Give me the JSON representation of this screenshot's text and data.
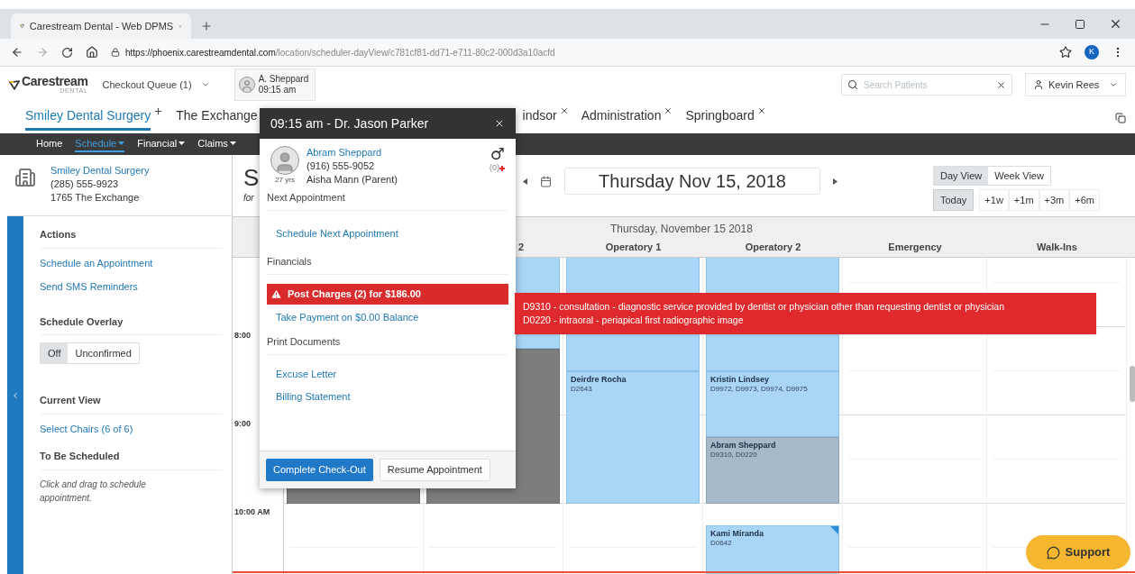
{
  "browser": {
    "tab_title": "Carestream Dental - Web DPMS",
    "url_host": "https://phoenix.carestreamdental.com",
    "url_path": "/location/scheduler-dayView/c781cf81-dd71-e711-80c2-000d3a10acfd",
    "profile_initial": "K"
  },
  "header": {
    "logo": "Carestream",
    "logo_sub": "DENTAL",
    "checkout_queue": "Checkout Queue (1)",
    "queue_chip": {
      "name": "A. Sheppard",
      "time": "09:15 am"
    },
    "search": {
      "placeholder": "Search Patients"
    },
    "user": "Kevin Rees"
  },
  "location_tabs": [
    {
      "label": "Smiley Dental Surgery",
      "selected": true,
      "kind": "add"
    },
    {
      "label": "The Exchange",
      "selected": false,
      "kind": "plain"
    },
    {
      "label": "indsor",
      "selected": false,
      "kind": "close"
    },
    {
      "label": "Administration",
      "selected": false,
      "kind": "close"
    },
    {
      "label": "Springboard",
      "selected": false,
      "kind": "close"
    }
  ],
  "nav": [
    {
      "label": "Home",
      "selected": false,
      "dropdown": false
    },
    {
      "label": "Schedule",
      "selected": true,
      "dropdown": true
    },
    {
      "label": "Financial",
      "selected": false,
      "dropdown": true
    },
    {
      "label": "Claims",
      "selected": false,
      "dropdown": true
    }
  ],
  "location": {
    "name": "Smiley Dental Surgery",
    "phone": "(285) 555-9923",
    "address": "1765 The Exchange"
  },
  "sidebar": {
    "actions_title": "Actions",
    "actions": [
      "Schedule an Appointment",
      "Send SMS Reminders"
    ],
    "overlay_title": "Schedule Overlay",
    "overlay_options": [
      {
        "label": "Off",
        "selected": true
      },
      {
        "label": "Unconfirmed",
        "selected": false
      }
    ],
    "current_view_title": "Current View",
    "current_view_link": "Select Chairs (6 of 6)",
    "to_be_scheduled_title": "To Be Scheduled",
    "to_be_scheduled_note": "Click and drag to schedule appointment."
  },
  "schedule": {
    "title_fragment": "S",
    "subtitle_fragment": "for",
    "date": "Thursday Nov 15, 2018",
    "view_options": [
      {
        "label": "Day View",
        "selected": true
      },
      {
        "label": "Week View",
        "selected": false
      }
    ],
    "today": "Today",
    "jumps": [
      "+1w",
      "+1m",
      "+3m",
      "+6m"
    ]
  },
  "grid": {
    "date_heading": "Thursday, November 15 2018",
    "times": [
      "8:00",
      "9:00",
      "10:00 AM"
    ],
    "columns": [
      {
        "appointments": [
          {
            "kind": "completed"
          }
        ]
      },
      {
        "label": "2",
        "appointments": [
          {
            "kind": "scheduled"
          },
          {
            "kind": "completed"
          }
        ]
      },
      {
        "label": "Operatory 1",
        "appointments": [
          {
            "kind": "scheduled"
          },
          {
            "kind": "scheduled",
            "flagged": false,
            "name": "Deirdre Rocha",
            "codes": "D2643"
          }
        ]
      },
      {
        "label": "Operatory 2",
        "appointments": [
          {
            "kind": "scheduled"
          },
          {
            "kind": "scheduled",
            "flagged": false,
            "name": "Kristin Lindsey",
            "codes": "D9972, D9973, D9974, D9975"
          },
          {
            "kind": "checked_in",
            "flagged": false,
            "name": "Abram Sheppard",
            "codes": "D9310, D0220"
          },
          {
            "kind": "scheduled",
            "flagged": true,
            "name": "Kami Miranda",
            "codes": "D0642"
          }
        ]
      },
      {
        "label": "Emergency"
      },
      {
        "label": "Walk-Ins"
      }
    ]
  },
  "popup": {
    "title": "09:15 am - Dr. Jason Parker",
    "patient": {
      "name": "Abram Sheppard",
      "phone": "(916) 555-9052",
      "guardian": "Aisha Mann (Parent)",
      "age": "27 yrs",
      "gender": "♂",
      "alerts": "(0)"
    },
    "sections": [
      {
        "heading": "Next Appointment",
        "items": [
          {
            "label": "Schedule Next Appointment",
            "kind": "link"
          }
        ]
      },
      {
        "heading": "Financials",
        "items": [
          {
            "label": "Post Charges (2) for $186.00",
            "kind": "alert"
          },
          {
            "label": "Take Payment on $0.00 Balance",
            "kind": "link"
          }
        ]
      },
      {
        "heading": "Print Documents",
        "items": [
          {
            "label": "Excuse Letter",
            "kind": "link"
          },
          {
            "label": "Billing Statement",
            "kind": "link"
          }
        ]
      }
    ],
    "buttons": [
      {
        "label": "Complete Check-Out",
        "kind": "primary"
      },
      {
        "label": "Resume Appointment",
        "kind": "secondary"
      }
    ]
  },
  "tooltip": {
    "lines": [
      "D9310 - consultation - diagnostic service provided by dentist or physician other than requesting dentist or physician",
      "D0220 - intraoral - periapical first radiographic image"
    ]
  },
  "support": {
    "label": "Support"
  }
}
